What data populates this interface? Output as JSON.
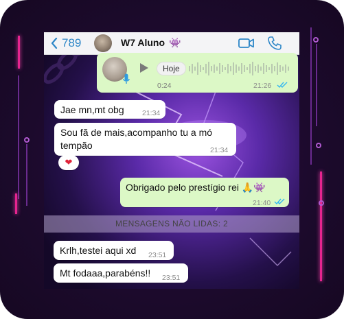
{
  "header": {
    "back_count": "789",
    "contact_name": "W7 Aluno",
    "contact_emoji": "👾"
  },
  "voice_message": {
    "badge": "Hoje",
    "duration": "0:24",
    "time": "21:26"
  },
  "messages": [
    {
      "text": "Jae mn,mt obg",
      "time": "21:34"
    },
    {
      "text_line1": "Sou fã de mais,acompanho tu a mó",
      "text_line2": "tempão",
      "time": "21:34",
      "reaction": "❤"
    },
    {
      "text": "Obrigado pelo prestígio rei 🙏👾",
      "time": "21:40"
    }
  ],
  "unread_banner": "MENSAGENS NÃO LIDAS: 2",
  "new_messages": [
    {
      "text": "Krlh,testei aqui xd",
      "time": "23:51"
    },
    {
      "text": "Mt fodaaa,parabéns!!",
      "time": "23:51"
    }
  ],
  "colors": {
    "outgoing_bubble": "#dcf8c6",
    "incoming_bubble": "#ffffff",
    "accent_blue": "#2c86c7",
    "neon_pink": "#e6248f"
  },
  "icons": [
    "back-chevron-icon",
    "video-call-icon",
    "phone-call-icon",
    "play-icon",
    "mic-icon",
    "read-ticks-icon",
    "alien-monster-emoji"
  ]
}
